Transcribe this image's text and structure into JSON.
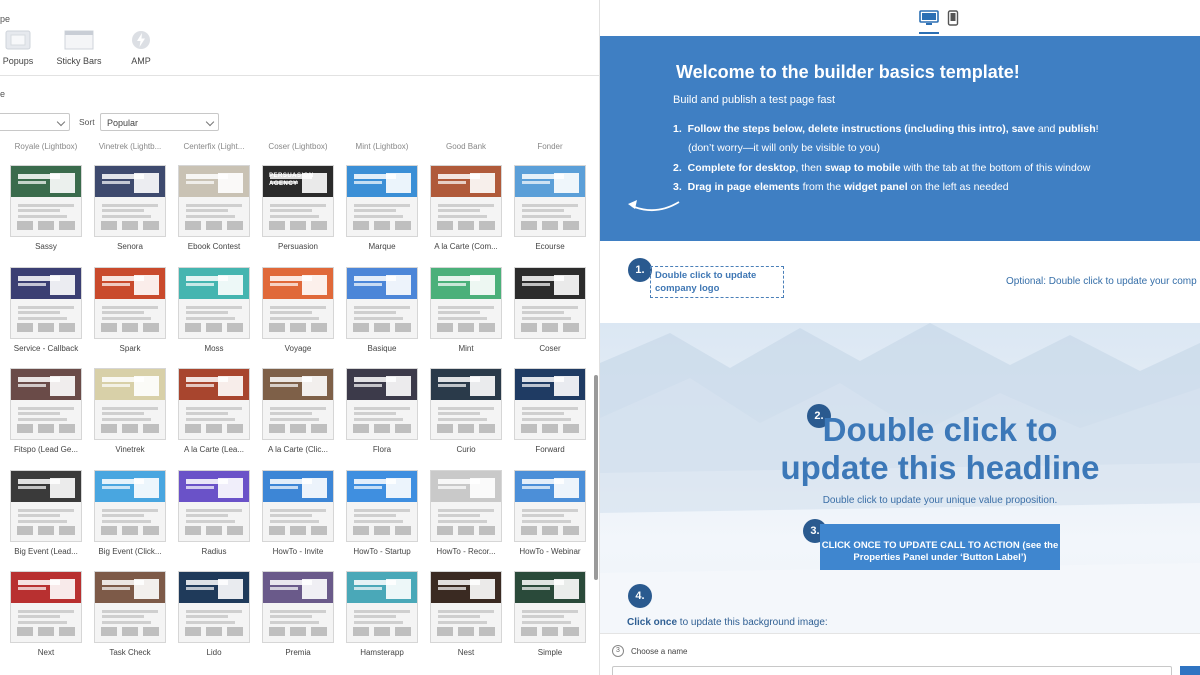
{
  "left_panel": {
    "type_label_cut": "pe",
    "types": [
      {
        "label": "Popups",
        "icon": "popup-icon"
      },
      {
        "label": "Sticky Bars",
        "icon": "sticky-bar-icon"
      },
      {
        "label": "AMP",
        "icon": "amp-bolt-icon"
      }
    ],
    "filter_label_cut": "e",
    "sort_label": "Sort",
    "sort_value": "Popular",
    "row0_labels": [
      "Royale (Lightbox)",
      "Vinetrek (Lightb...",
      "Centerfix (Light...",
      "Coser (Lightbox)",
      "Mint (Lightbox)",
      "Good Bank",
      "Fonder"
    ],
    "rows": [
      [
        "Sassy",
        "Senora",
        "Ebook Contest",
        "Persuasion",
        "Marque",
        "A la Carte (Com...",
        "Ecourse"
      ],
      [
        "Service - Callback",
        "Spark",
        "Moss",
        "Voyage",
        "Basique",
        "Mint",
        "Coser"
      ],
      [
        "Fitspo (Lead Ge...",
        "Vinetrek",
        "A la Carte (Lea...",
        "A la Carte (Clic...",
        "Flora",
        "Curio",
        "Forward"
      ],
      [
        "Big Event (Lead...",
        "Big Event (Click...",
        "Radius",
        "HowTo - Invite",
        "HowTo - Startup",
        "HowTo - Recor...",
        "HowTo - Webinar"
      ],
      [
        "Next",
        "Task Check",
        "Lido",
        "Premia",
        "Hamsterapp",
        "Nest",
        "Simple"
      ]
    ],
    "thumb_colors": [
      [
        "#3a6b4c",
        "#3e4a6e",
        "#c9c2b4",
        "#2b2b2b",
        "#3b8fd6",
        "#b05a3a",
        "#5b9fd8"
      ],
      [
        "#3b3f73",
        "#c94a2c",
        "#45b5b0",
        "#e0693a",
        "#4c86d8",
        "#4bb07a",
        "#2c2c2c"
      ],
      [
        "#6a4b48",
        "#d8d0a8",
        "#a8452e",
        "#7e6048",
        "#3c3a4a",
        "#2a3a4a",
        "#1f3b63"
      ],
      [
        "#3a3a3a",
        "#49a6e0",
        "#6a52c8",
        "#3d86d6",
        "#3f8fe0",
        "#c9c9c9",
        "#4c8fd8"
      ],
      [
        "#b83030",
        "#7d5a48",
        "#1f3a5a",
        "#6a5a8a",
        "#4aa8b8",
        "#3a2a22",
        "#2a4a3a"
      ]
    ],
    "persuasion_text": "PERSUASION AGENCY"
  },
  "preview": {
    "device_icons": [
      "desktop-icon",
      "mobile-icon"
    ],
    "intro": {
      "title": "Welcome to the builder basics template!",
      "subtitle": "Build and publish a test page fast",
      "step1_num": "1.",
      "step1_a": "Follow the steps below, delete instructions (including this intro), save",
      "step1_b": " and ",
      "step1_c": "publish",
      "step1_d": "!",
      "step1_line2": "(don’t worry—it will only be visible to you)",
      "step2_num": "2.",
      "step2_a": "Complete for desktop",
      "step2_b": ", then ",
      "step2_c": "swap to mobile",
      "step2_d": " with the tab at the bottom of this window",
      "step3_num": "3.",
      "step3_a": "Drag in page elements",
      "step3_b": " from the ",
      "step3_c": "widget panel",
      "step3_d": " on the left as needed"
    },
    "header": {
      "badge1": "1.",
      "logo_text": "Double click to update company logo",
      "optional_text": "Optional: Double click to update your comp"
    },
    "hero": {
      "badge2": "2.",
      "headline_line1": "Double click to",
      "headline_line2": "update this headline",
      "uvp": "Double click to update your unique value proposition.",
      "badge3": "3.",
      "cta_line1": "CLICK ONCE TO UPDATE CALL TO ACTION  (see the",
      "cta_line2": "Properties Panel under ‘Button Label’)",
      "badge4": "4.",
      "bg_text_bold": "Click once",
      "bg_text_rest": " to update this background image:"
    },
    "bottom": {
      "name_icon": "3",
      "name_label": "Choose a name"
    }
  }
}
